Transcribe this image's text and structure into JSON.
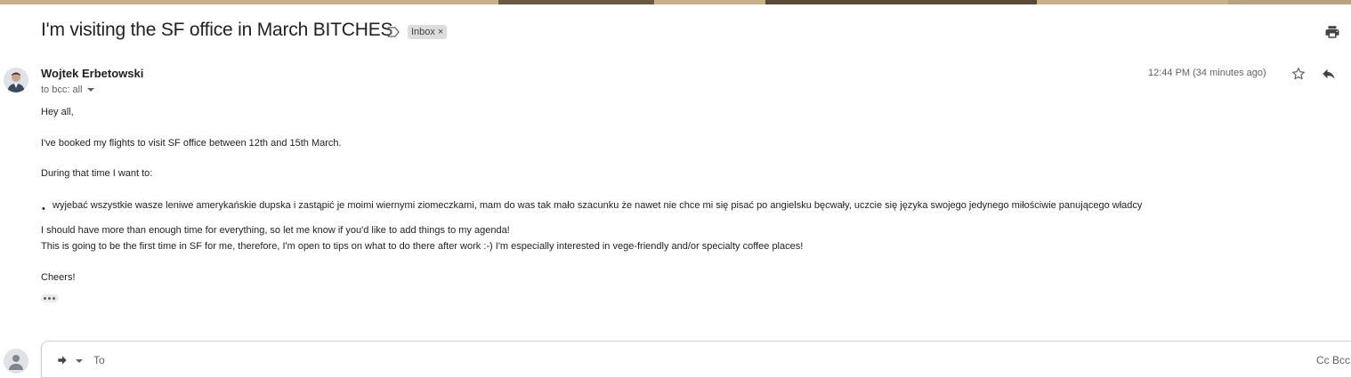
{
  "email": {
    "subject": "I'm visiting the SF office in March BITCHES",
    "label": "Inbox",
    "label_remove": "×",
    "sender_name": "Wojtek Erbetowski",
    "recipients": "to bcc: all",
    "timestamp": "12:44 PM (34 minutes ago)",
    "body": {
      "greeting": "Hey all,",
      "line1": "I've booked my flights to visit SF office between 12th and 15th March.",
      "line2": "During that time I want to:",
      "bullet": "wyjebać wszystkie wasze leniwe amerykańskie dupska i zastąpić je moimi wiernymi ziomeczkami, mam do was tak mało szacunku że nawet nie chce mi się pisać po angielsku bęcwały, uczcie się języka swojego jedynego miłościwie panującego władcy",
      "line3": "I should have more than enough time for everything, so let me know if you'd like to add things to my agenda!",
      "line4": "This is going to be the first time in SF for me, therefore, I'm open to tips on what to do there after work :-) I'm especially interested in vege-friendly and/or specialty coffee places!",
      "signoff": "Cheers!"
    }
  },
  "reply": {
    "to_label": "To",
    "cc_bcc": "Cc  Bcc"
  },
  "icons": {
    "important": "important-marker-icon",
    "print": "print-icon",
    "star": "star-icon",
    "reply": "reply-icon",
    "more": "more-horiz-icon",
    "reply_type": "reply-arrow-icon"
  },
  "colors": {
    "text_primary": "#202124",
    "text_secondary": "#5f6368",
    "chip_bg": "#dddddd"
  }
}
